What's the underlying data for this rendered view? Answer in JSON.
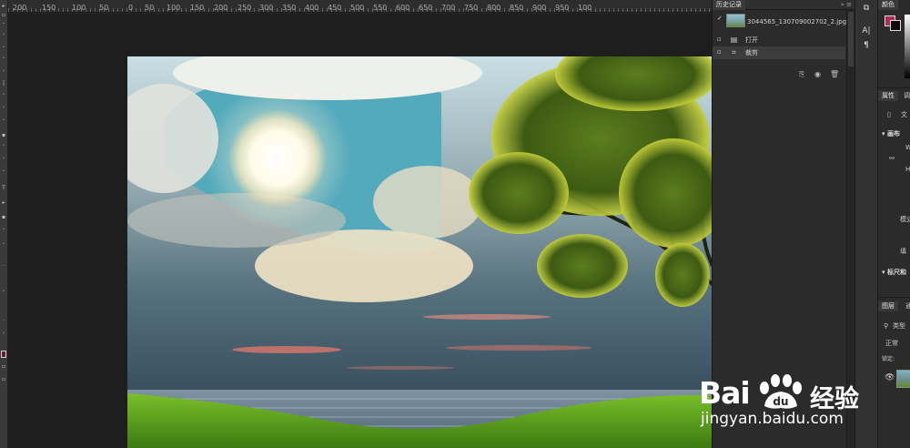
{
  "ruler": {
    "ticks": [
      "200",
      "150",
      "100",
      "50",
      "0",
      "50",
      "100",
      "150",
      "200",
      "250",
      "300",
      "350",
      "400",
      "450",
      "500",
      "550",
      "600",
      "650",
      "700",
      "750",
      "800",
      "850",
      "900",
      "950",
      "100"
    ]
  },
  "history": {
    "title": "历史记录",
    "menu": "»  ≡",
    "snapshot_label": "3044565_130709002702_2.jpg",
    "items": [
      {
        "label": "打开",
        "icon": "document-icon"
      },
      {
        "label": "裁剪",
        "icon": "crop-icon"
      }
    ],
    "footer_icons": [
      "new-document-from-state-icon",
      "camera-icon",
      "trash-icon"
    ]
  },
  "props": {
    "color_tab": "颜色",
    "properties_tab": "属性",
    "properties_tab2": "调",
    "doc_label": "文",
    "canvas_section": "画布",
    "w_label": "W",
    "h_label": "H",
    "mode_label": "模式",
    "fill_label": "填",
    "rulers_section": "标尺和",
    "layers_tab": "图层",
    "layers_tab2": "通",
    "kind_search": "类型",
    "blend_mode": "正常",
    "lock_label": "锁定:"
  },
  "strip": {
    "icons": [
      "history-icon",
      "character-icon",
      "paragraph-icon"
    ]
  },
  "watermark": {
    "brand": "Bai",
    "brand_cn": "经验",
    "url": "jingyan.baidu.com"
  },
  "colors": {
    "foreground": "#b02a5a",
    "background": "#120a0a"
  }
}
